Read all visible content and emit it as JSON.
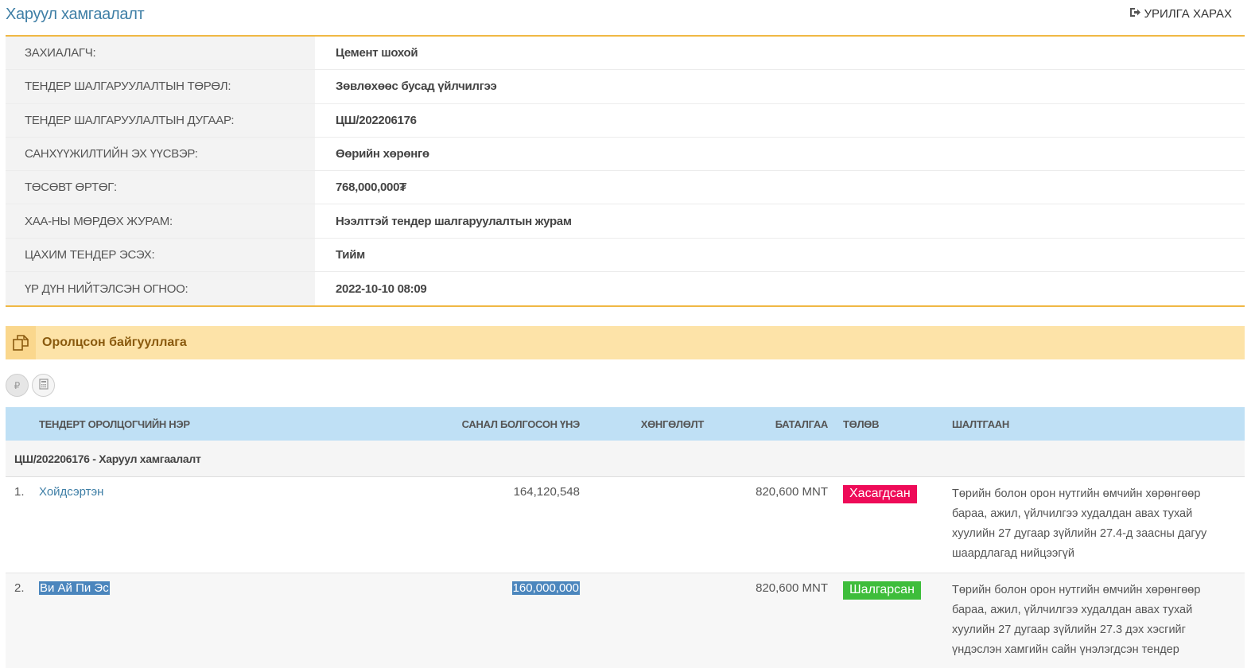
{
  "header": {
    "title": "Харуул хамгаалалт",
    "invite_label": "УРИЛГА ХАРАХ"
  },
  "info": [
    {
      "label": "ЗАХИАЛАГЧ:",
      "value": "Цемент шохой"
    },
    {
      "label": "ТЕНДЕР ШАЛГАРУУЛАЛТЫН ТӨРӨЛ:",
      "value": "Зөвлөхөөс бусад үйлчилгээ"
    },
    {
      "label": "ТЕНДЕР ШАЛГАРУУЛАЛТЫН ДУГААР:",
      "value": "ЦШ/202206176"
    },
    {
      "label": "САНХҮҮЖИЛТИЙН ЭХ ҮҮСВЭР:",
      "value": "Өөрийн хөрөнгө"
    },
    {
      "label": "ТӨСӨВТ ӨРТӨГ:",
      "value": "768,000,000₮"
    },
    {
      "label": "ХАА-НЫ МӨРДӨХ ЖУРАМ:",
      "value": "Нээлттэй тендер шалгаруулалтын журам"
    },
    {
      "label": "ЦАХИМ ТЕНДЕР ЭСЭХ:",
      "value": "Тийм"
    },
    {
      "label": "ҮР ДҮН НИЙТЭЛСЭН ОГНОО:",
      "value": "2022-10-10 08:09"
    }
  ],
  "section": {
    "title": "Оролцсон байгууллага",
    "icon": "copy-icon"
  },
  "toolbar": {
    "buttons": [
      "currency-icon",
      "calculator-icon"
    ]
  },
  "bidders": {
    "headers": {
      "name": "ТЕНДЕРТ ОРОЛЦОГЧИЙН НЭР",
      "price": "САНАЛ БОЛГОСОН ҮНЭ",
      "discount": "ХӨНГӨЛӨЛТ",
      "guarantee": "БАТАЛГАА",
      "status": "ТӨЛӨВ",
      "reason": "ШАЛТГААН"
    },
    "group_label": "ЦШ/202206176 - Харуул хамгаалалт",
    "rows": [
      {
        "num": "1.",
        "name": "Хойдсэртэн",
        "price": "164,120,548",
        "discount": "",
        "guarantee": "820,600 MNT",
        "status": "Хасагдсан",
        "status_color": "#ee0b58",
        "reason": "Төрийн болон орон нутгийн өмчийн хөрөнгөөр бараа, ажил, үйлчилгээ худалдан авах тухай хуулийн 27 дугаар зүйлийн 27.4-д заасны дагуу шаардлагад нийцээгүй"
      },
      {
        "num": "2.",
        "name": "Ви Ай Пи Эс",
        "price": "160,000,000",
        "discount": "",
        "guarantee": "820,600 MNT",
        "status": "Шалгарсан",
        "status_color": "#3ebd3b",
        "reason": "Төрийн болон орон нутгийн өмчийн хөрөнгөөр бараа, ажил, үйлчилгээ худалдан авах тухай хуулийн 27 дугаар зүйлийн 27.3 дэх хэсгийг үндэслэн хамгийн сайн үнэлэгдсэн тендер"
      }
    ]
  }
}
